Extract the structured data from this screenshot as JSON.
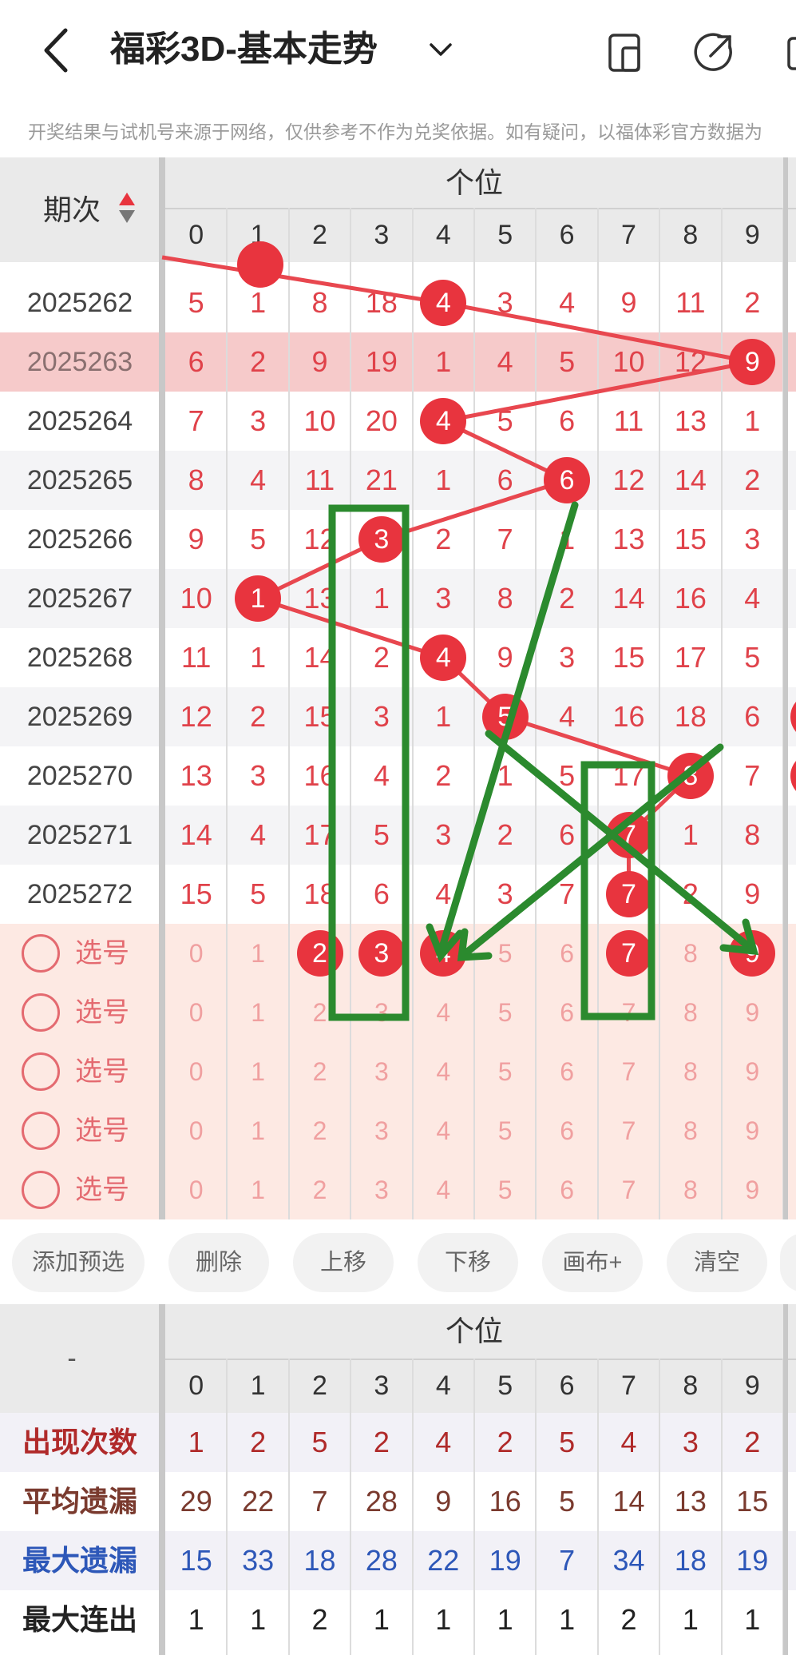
{
  "header": {
    "title": "福彩3D-基本走势",
    "notice": "开奖结果与试机号来源于网络，仅供参考不作为兑奖依据。如有疑问，以福体彩官方数据为"
  },
  "table": {
    "period_header": "期次",
    "section_label": "个位",
    "digits": [
      "0",
      "1",
      "2",
      "3",
      "4",
      "5",
      "6",
      "7",
      "8",
      "9"
    ],
    "rows": [
      {
        "period": "2025262",
        "values": [
          5,
          1,
          8,
          18,
          4,
          3,
          4,
          9,
          11,
          2
        ],
        "hit": 4
      },
      {
        "period": "2025263",
        "values": [
          6,
          2,
          9,
          19,
          1,
          4,
          5,
          10,
          12,
          9
        ],
        "hit": 9
      },
      {
        "period": "2025264",
        "values": [
          7,
          3,
          10,
          20,
          4,
          5,
          6,
          11,
          13,
          1
        ],
        "hit": 4
      },
      {
        "period": "2025265",
        "values": [
          8,
          4,
          11,
          21,
          1,
          6,
          6,
          12,
          14,
          2
        ],
        "hit": 6
      },
      {
        "period": "2025266",
        "values": [
          9,
          5,
          12,
          3,
          2,
          7,
          1,
          13,
          15,
          3
        ],
        "hit": 3
      },
      {
        "period": "2025267",
        "values": [
          10,
          1,
          13,
          1,
          3,
          8,
          2,
          14,
          16,
          4
        ],
        "hit": 1
      },
      {
        "period": "2025268",
        "values": [
          11,
          1,
          14,
          2,
          4,
          9,
          3,
          15,
          17,
          5
        ],
        "hit": 4
      },
      {
        "period": "2025269",
        "values": [
          12,
          2,
          15,
          3,
          1,
          5,
          4,
          16,
          18,
          6
        ],
        "hit": 5
      },
      {
        "period": "2025270",
        "values": [
          13,
          3,
          16,
          4,
          2,
          1,
          5,
          17,
          8,
          7
        ],
        "hit": 8
      },
      {
        "period": "2025271",
        "values": [
          14,
          4,
          17,
          5,
          3,
          2,
          6,
          7,
          1,
          8
        ],
        "hit": 7
      },
      {
        "period": "2025272",
        "values": [
          15,
          5,
          18,
          6,
          4,
          3,
          7,
          7,
          2,
          9
        ],
        "hit": 7
      }
    ],
    "pick_label": "选号",
    "pick_rows": [
      {
        "selected": [
          2,
          3,
          4,
          7,
          9
        ]
      },
      {
        "selected": []
      },
      {
        "selected": []
      },
      {
        "selected": []
      },
      {
        "selected": []
      }
    ]
  },
  "toolbar": {
    "add": "添加预选",
    "delete": "删除",
    "up": "上移",
    "down": "下移",
    "canvas": "画布+",
    "clear": "清空"
  },
  "stats": {
    "corner": "-",
    "section_label": "个位",
    "rows": [
      {
        "label": "出现次数",
        "values": [
          1,
          2,
          5,
          2,
          4,
          2,
          5,
          4,
          3,
          2
        ],
        "color": "#b02a2a"
      },
      {
        "label": "平均遗漏",
        "values": [
          29,
          22,
          7,
          28,
          9,
          16,
          5,
          14,
          13,
          15
        ],
        "color": "#7a3a2e"
      },
      {
        "label": "最大遗漏",
        "values": [
          15,
          33,
          18,
          28,
          22,
          19,
          7,
          34,
          18,
          19
        ],
        "color": "#2d57b8"
      },
      {
        "label": "最大连出",
        "values": [
          1,
          1,
          2,
          1,
          1,
          1,
          1,
          2,
          1,
          1
        ],
        "color": "#222222"
      }
    ]
  },
  "colors": {
    "accent": "#e8343e",
    "highlight_row": "#f6caca",
    "pick_area": "#fde9e3",
    "green_marks": "#2b8a2e"
  }
}
